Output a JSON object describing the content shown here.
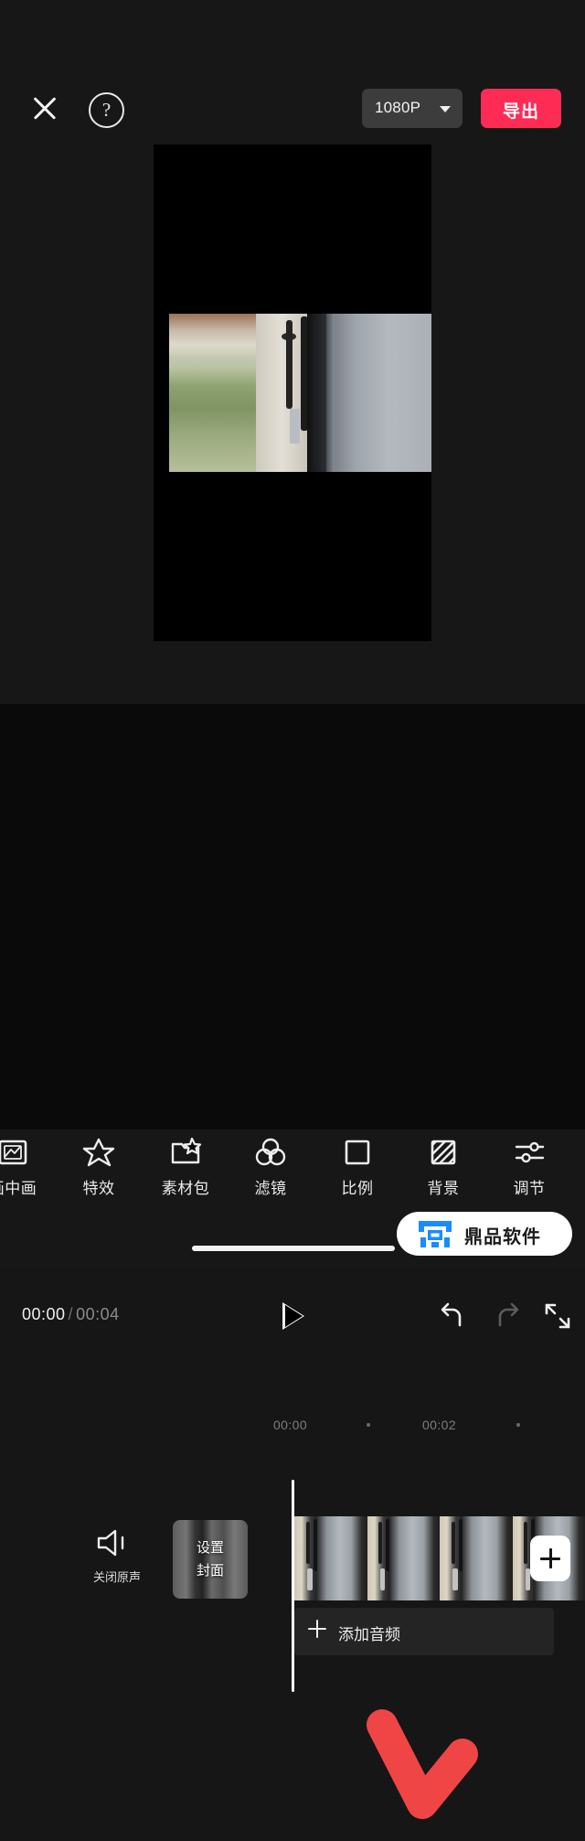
{
  "app": {
    "name": "video-editor"
  },
  "topbar": {
    "close_icon": "close-icon",
    "help_icon": "help-icon",
    "resolution": "1080P",
    "export_label": "导出"
  },
  "player": {
    "current_time": "00:00",
    "separator": "/",
    "total_time": "00:04",
    "play_icon": "play-icon",
    "undo_icon": "undo-icon",
    "redo_icon": "redo-icon",
    "fullscreen_icon": "fullscreen-icon"
  },
  "timeline": {
    "ruler_ticks": [
      "00:00",
      "00:02"
    ],
    "mute_label": "关闭原声",
    "mute_icon": "speaker-mute-icon",
    "cover_line1": "设置",
    "cover_line2": "封面",
    "add_clip_icon": "plus-icon",
    "audio_track_label": "添加音频",
    "audio_add_icon": "plus-icon"
  },
  "annotation": {
    "arrow_color": "#f04545",
    "points_to": "背景"
  },
  "toolbar": {
    "items": [
      {
        "label": "画中画",
        "icon": "picture-in-picture-icon"
      },
      {
        "label": "特效",
        "icon": "star-effects-icon"
      },
      {
        "label": "素材包",
        "icon": "material-pack-icon"
      },
      {
        "label": "滤镜",
        "icon": "filter-circles-icon"
      },
      {
        "label": "比例",
        "icon": "aspect-ratio-icon"
      },
      {
        "label": "背景",
        "icon": "background-hatch-icon"
      },
      {
        "label": "调节",
        "icon": "adjust-sliders-icon"
      }
    ]
  },
  "watermark": {
    "text": "鼎品软件",
    "logo": "dingpin-logo-icon",
    "accent": "#1a8cff"
  },
  "colors": {
    "export": "#fe2c55",
    "background": "#171717",
    "timeline_bg": "#0a0a0a"
  }
}
